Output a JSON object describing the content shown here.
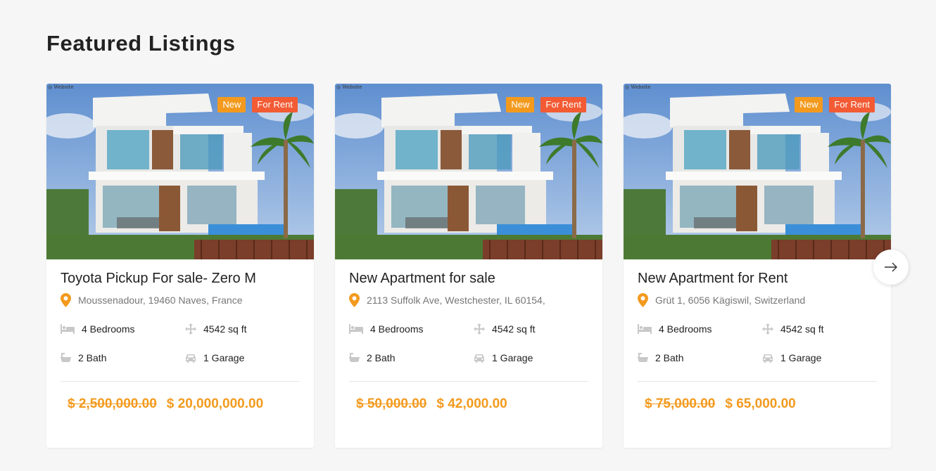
{
  "section": {
    "title": "Featured Listings"
  },
  "colors": {
    "accent": "#f39a1e",
    "badge_rent": "#f25b34",
    "icon_gray": "#c8c8c8"
  },
  "listings": [
    {
      "badges": {
        "new": "New",
        "status": "For Rent"
      },
      "title": "Toyota Pickup For sale- Zero M",
      "address": "Moussenadour, 19460 Naves, France",
      "bedrooms": "4 Bedrooms",
      "area": "4542 sq ft",
      "bath": "2 Bath",
      "garage": "1 Garage",
      "old_price": "$ 2,500,000.00",
      "price": "$ 20,000,000.00"
    },
    {
      "badges": {
        "new": "New",
        "status": "For Rent"
      },
      "title": "New Apartment for sale",
      "address": "2113 Suffolk Ave, Westchester, IL 60154,",
      "bedrooms": "4 Bedrooms",
      "area": "4542 sq ft",
      "bath": "2 Bath",
      "garage": "1 Garage",
      "old_price": "$ 50,000.00",
      "price": "$ 42,000.00"
    },
    {
      "badges": {
        "new": "New",
        "status": "For Rent"
      },
      "title": "New Apartment for Rent",
      "address": "Grüt 1, 6056 Kägiswil, Switzerland",
      "bedrooms": "4 Bedrooms",
      "area": "4542 sq ft",
      "bath": "2 Bath",
      "garage": "1 Garage",
      "old_price": "$ 75,000.00",
      "price": "$ 65,000.00"
    }
  ],
  "icons": {
    "location": "location-pin-icon",
    "bed": "bed-icon",
    "area": "move-arrows-icon",
    "bath": "bathtub-icon",
    "garage": "car-icon",
    "next": "arrow-right-icon"
  }
}
